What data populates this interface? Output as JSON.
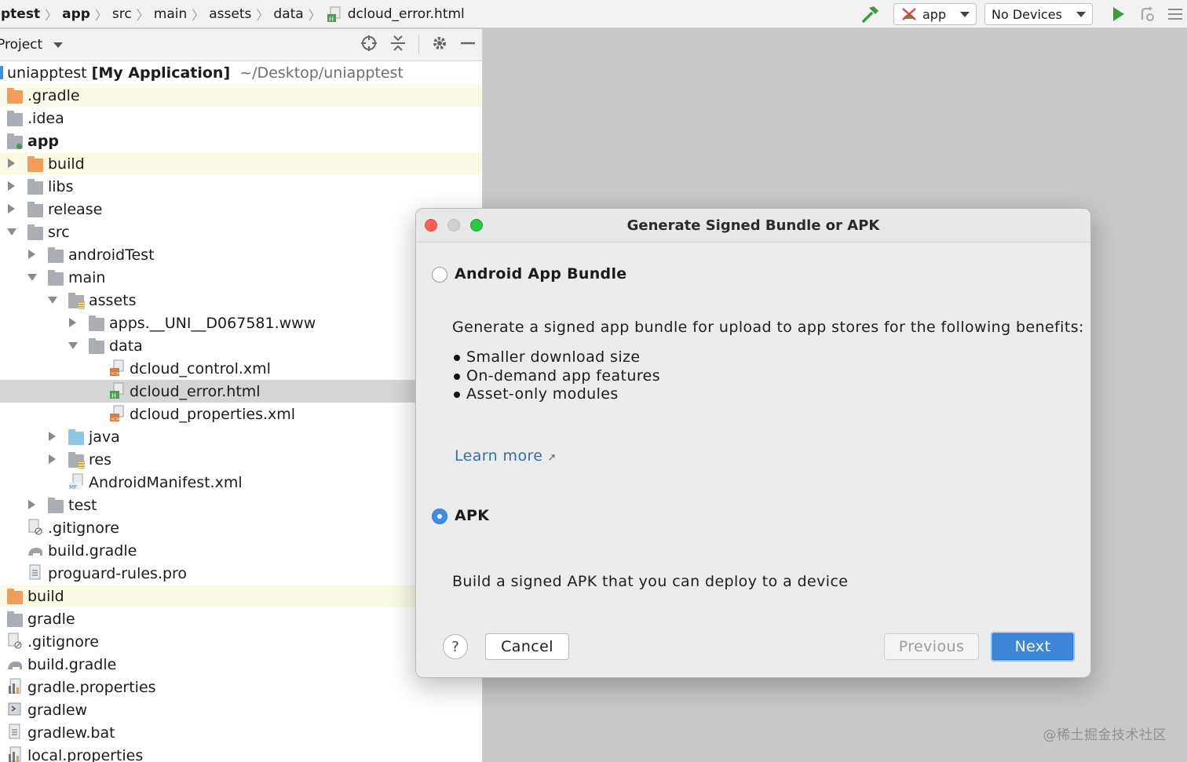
{
  "toolbar": {
    "breadcrumbs": [
      "ptest",
      "app",
      "src",
      "main",
      "assets",
      "data"
    ],
    "current_file": "dcloud_error.html",
    "run_config": "app",
    "device": "No Devices"
  },
  "project_panel": {
    "title": "Project",
    "root": {
      "name": "uniapptest",
      "module": "[My Application]",
      "path": "~/Desktop/uniapptest"
    },
    "items": [
      ".gradle",
      ".idea",
      "app",
      "build",
      "libs",
      "release",
      "src",
      "androidTest",
      "main",
      "assets",
      "apps.__UNI__D067581.www",
      "data",
      "dcloud_control.xml",
      "dcloud_error.html",
      "dcloud_properties.xml",
      "java",
      "res",
      "AndroidManifest.xml",
      "test",
      ".gitignore",
      "build.gradle",
      "proguard-rules.pro",
      "build",
      "gradle",
      ".gitignore",
      "build.gradle",
      "gradle.properties",
      "gradlew",
      "gradlew.bat",
      "local.properties"
    ]
  },
  "dialog": {
    "title": "Generate Signed Bundle or APK",
    "option_bundle": {
      "label": "Android App Bundle",
      "selected": false,
      "description": "Generate a signed app bundle for upload to app stores for the following benefits:",
      "benefits": [
        "Smaller download size",
        "On-demand app features",
        "Asset-only modules"
      ],
      "learn_more": "Learn more",
      "learn_more_icon": "external-link-arrow"
    },
    "option_apk": {
      "label": "APK",
      "selected": true,
      "description": "Build a signed APK that you can deploy to a device"
    },
    "buttons": {
      "help": "?",
      "cancel": "Cancel",
      "previous": "Previous",
      "next": "Next"
    }
  },
  "watermark": "@稀土掘金技术社区",
  "colors": {
    "accent": "#3d86d8",
    "link": "#2c6fb5",
    "run": "#3f9b4a",
    "close": "#fe5f57",
    "zoom": "#28c840",
    "selection": "#d5d5d5",
    "highlight": "#fbfae6"
  }
}
